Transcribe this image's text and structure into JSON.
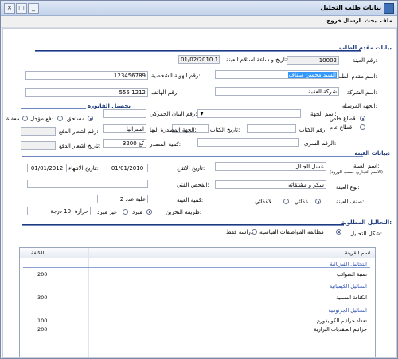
{
  "window": {
    "title": "بيانات طلب التحليل",
    "minimize": "_",
    "maximize": "□",
    "close": "×"
  },
  "menu": {
    "m1": "ملف",
    "m2": "بحث",
    "m3": "ارسال",
    "m4": "خروج"
  },
  "applicant": {
    "section": "بيانات مقدم الطلب",
    "sample_no_label": "رقم العينة:",
    "sample_no": "10002",
    "received_label": "تاريخ و ساعة استلام العينة:",
    "received": "01/02/2010 11:00",
    "applicant_name_label": "اسم مقدم الطلب:",
    "applicant_name": "السيد محسن سقاف",
    "id_no_label": "رقم الهوية الشخصية:",
    "id_no": "123456789",
    "company_label": "اسم الشركة:",
    "company": "شركة العقبة",
    "phone_label": "رقم الهاتف:",
    "phone": "555 1212",
    "sender_label": "الجهة المرسلة:"
  },
  "party": {
    "name_label": "اسم الجهة:",
    "private": "قطاع خاص",
    "public": "قطاع عام",
    "book_no_label": "رقم الكتاب:",
    "book_date_label": "تاريخ الكتاب:",
    "secret_no_label": "الرقم السري:"
  },
  "billing": {
    "section": "تحصيل الفاتورة",
    "paid": "مستحق",
    "deferred": "دفع مؤجل",
    "exempt": "معفاة",
    "notice_no_label": "رقم اشعار الدفع:",
    "notice_date_label": "تاريخ اشعار الدفع:",
    "customs_label": "رقم البيان الجمركي:",
    "issuer_label": "الجهة المصدرة إليها:",
    "issuer": "استراليا",
    "export_qty_label": "كمية المصدر:",
    "export_qty": "3200 كغ"
  },
  "sample": {
    "section": "بيانات العينة:",
    "name_label": "اسم العينة:",
    "name_hint": "(الاسم التجاري حسب الورود)",
    "name": "عسل الجبال",
    "prod_date_label": "تاريخ الانتاج:",
    "prod_date": "01/01/2010",
    "expiry_label": "تاريخ الانتهاء:",
    "expiry": "01/01/2012",
    "type_label": "نوع العينة:",
    "type": "سكر و مشتقاته",
    "tech_label": "الفحص الفني:",
    "qty_label": "كمية العينة:",
    "qty": "علبة عدد 2",
    "class_label": "صنف العينة:",
    "food": "غذائي",
    "nonfood": "لاغذائي",
    "storage_label": "طريقة التخزين:",
    "chilled": "مبرد",
    "not_chilled": "غير مبرد",
    "temp": "حرارة -10 درجة"
  },
  "analysis": {
    "section": "التحاليل المطلوبة:",
    "shape_label": "شكل التحليل:",
    "opt1": "مطابقة المواصفات القياسية",
    "opt2": "دراسة فقط",
    "col_name": "اسم القرينة",
    "col_cost": "الكلفة",
    "g1": "التحاليل الفيزيائية",
    "r1": "نسبة الشوائب",
    "r1c": "200",
    "g2": "التحاليل الكيميائية",
    "r2": "الكثافة النسبية",
    "r2c": "300",
    "g3": "التحاليل الجرثومية",
    "r3": "تعداد جراثيم الكوليفورم",
    "r3c": "100",
    "r4": "جراثيم العنقديات البرازية",
    "r4c": "200"
  }
}
